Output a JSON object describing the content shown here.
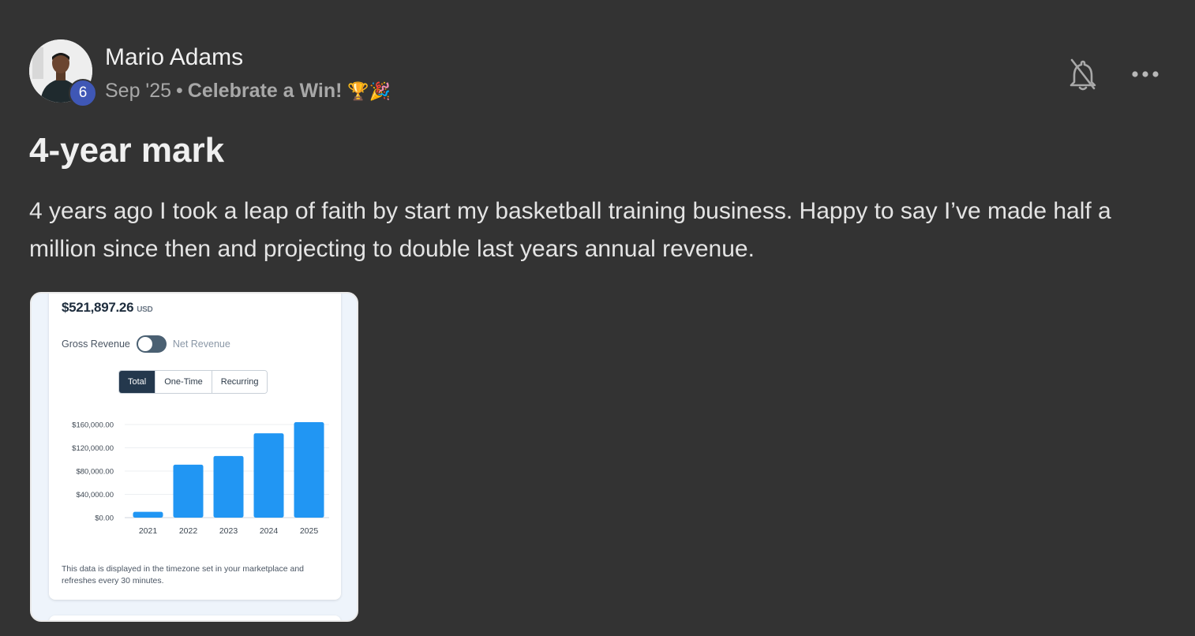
{
  "post": {
    "author": {
      "name": "Mario Adams",
      "level": "6",
      "avatar_icon": "person-avatar-icon"
    },
    "date": "Sep '25",
    "separator": "•",
    "category": "Celebrate a Win!",
    "category_emoji": "🏆🎉",
    "title": "4-year mark",
    "body": "4 years ago I took a leap of faith by start my basketball training business. Happy to say I’ve made half a million since then and projecting to double last years annual revenue.",
    "actions": {
      "bell_icon": "bell-off-icon",
      "more_icon": "more-horizontal-icon"
    }
  },
  "attachment": {
    "amount": "$521,897.26",
    "currency": "USD",
    "toggle": {
      "left_label": "Gross Revenue",
      "right_label": "Net Revenue"
    },
    "segments": [
      "Total",
      "One-Time",
      "Recurring"
    ],
    "active_segment": "Total",
    "footnote": "This data is displayed in the timezone set in your marketplace and refreshes every 30 minutes.",
    "colors": {
      "bar": "#2196f3",
      "active_segment": "#24384d"
    }
  },
  "chart_data": {
    "type": "bar",
    "categories": [
      "2021",
      "2022",
      "2023",
      "2024",
      "2025"
    ],
    "values": [
      10000,
      91000,
      106000,
      145000,
      164000
    ],
    "y_ticks": [
      "$160,000.00",
      "$120,000.00",
      "$80,000.00",
      "$40,000.00",
      "$0.00"
    ],
    "ylim": [
      0,
      160000
    ],
    "grid": true,
    "title": "",
    "xlabel": "",
    "ylabel": ""
  }
}
